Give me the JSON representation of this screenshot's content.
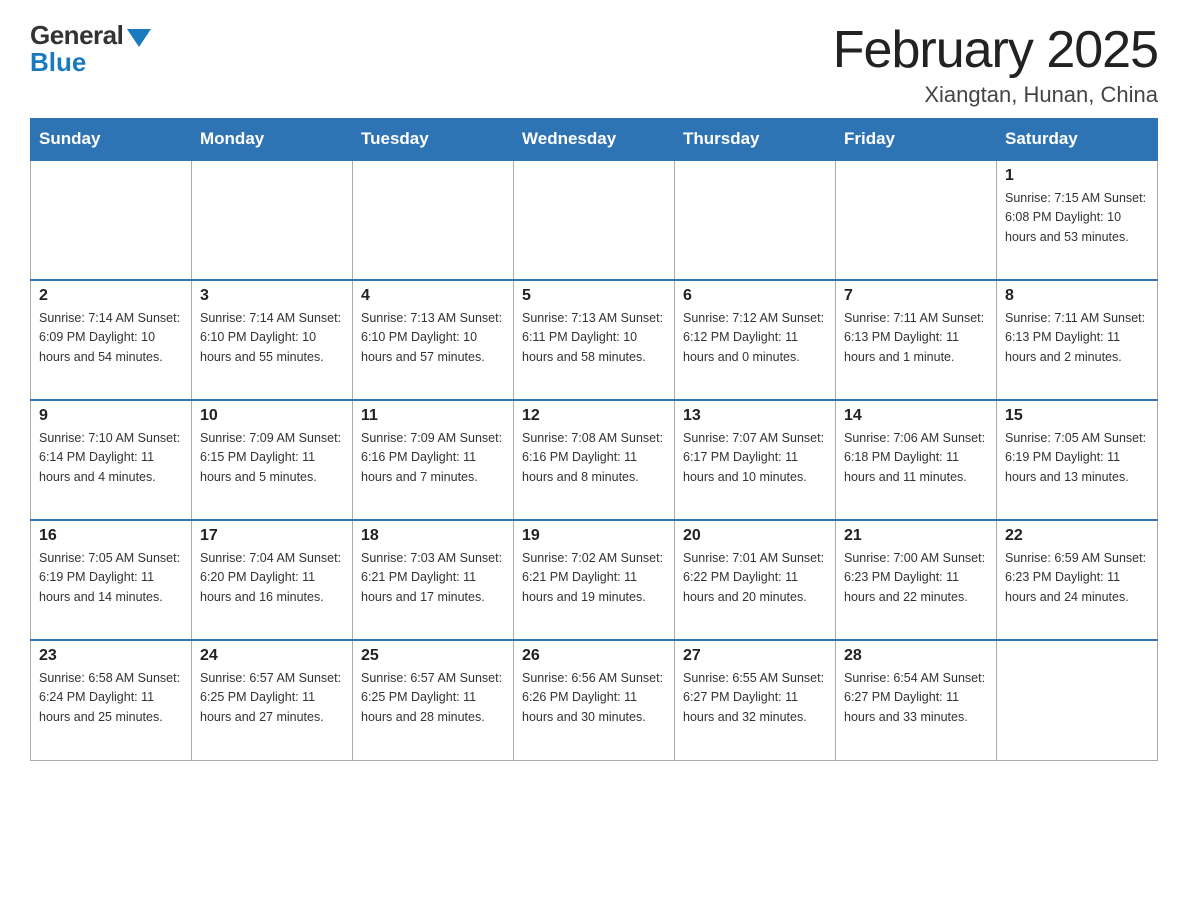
{
  "header": {
    "logo_general": "General",
    "logo_blue": "Blue",
    "title": "February 2025",
    "location": "Xiangtan, Hunan, China"
  },
  "days_of_week": [
    "Sunday",
    "Monday",
    "Tuesday",
    "Wednesday",
    "Thursday",
    "Friday",
    "Saturday"
  ],
  "weeks": [
    [
      {
        "day": "",
        "info": ""
      },
      {
        "day": "",
        "info": ""
      },
      {
        "day": "",
        "info": ""
      },
      {
        "day": "",
        "info": ""
      },
      {
        "day": "",
        "info": ""
      },
      {
        "day": "",
        "info": ""
      },
      {
        "day": "1",
        "info": "Sunrise: 7:15 AM\nSunset: 6:08 PM\nDaylight: 10 hours\nand 53 minutes."
      }
    ],
    [
      {
        "day": "2",
        "info": "Sunrise: 7:14 AM\nSunset: 6:09 PM\nDaylight: 10 hours\nand 54 minutes."
      },
      {
        "day": "3",
        "info": "Sunrise: 7:14 AM\nSunset: 6:10 PM\nDaylight: 10 hours\nand 55 minutes."
      },
      {
        "day": "4",
        "info": "Sunrise: 7:13 AM\nSunset: 6:10 PM\nDaylight: 10 hours\nand 57 minutes."
      },
      {
        "day": "5",
        "info": "Sunrise: 7:13 AM\nSunset: 6:11 PM\nDaylight: 10 hours\nand 58 minutes."
      },
      {
        "day": "6",
        "info": "Sunrise: 7:12 AM\nSunset: 6:12 PM\nDaylight: 11 hours\nand 0 minutes."
      },
      {
        "day": "7",
        "info": "Sunrise: 7:11 AM\nSunset: 6:13 PM\nDaylight: 11 hours\nand 1 minute."
      },
      {
        "day": "8",
        "info": "Sunrise: 7:11 AM\nSunset: 6:13 PM\nDaylight: 11 hours\nand 2 minutes."
      }
    ],
    [
      {
        "day": "9",
        "info": "Sunrise: 7:10 AM\nSunset: 6:14 PM\nDaylight: 11 hours\nand 4 minutes."
      },
      {
        "day": "10",
        "info": "Sunrise: 7:09 AM\nSunset: 6:15 PM\nDaylight: 11 hours\nand 5 minutes."
      },
      {
        "day": "11",
        "info": "Sunrise: 7:09 AM\nSunset: 6:16 PM\nDaylight: 11 hours\nand 7 minutes."
      },
      {
        "day": "12",
        "info": "Sunrise: 7:08 AM\nSunset: 6:16 PM\nDaylight: 11 hours\nand 8 minutes."
      },
      {
        "day": "13",
        "info": "Sunrise: 7:07 AM\nSunset: 6:17 PM\nDaylight: 11 hours\nand 10 minutes."
      },
      {
        "day": "14",
        "info": "Sunrise: 7:06 AM\nSunset: 6:18 PM\nDaylight: 11 hours\nand 11 minutes."
      },
      {
        "day": "15",
        "info": "Sunrise: 7:05 AM\nSunset: 6:19 PM\nDaylight: 11 hours\nand 13 minutes."
      }
    ],
    [
      {
        "day": "16",
        "info": "Sunrise: 7:05 AM\nSunset: 6:19 PM\nDaylight: 11 hours\nand 14 minutes."
      },
      {
        "day": "17",
        "info": "Sunrise: 7:04 AM\nSunset: 6:20 PM\nDaylight: 11 hours\nand 16 minutes."
      },
      {
        "day": "18",
        "info": "Sunrise: 7:03 AM\nSunset: 6:21 PM\nDaylight: 11 hours\nand 17 minutes."
      },
      {
        "day": "19",
        "info": "Sunrise: 7:02 AM\nSunset: 6:21 PM\nDaylight: 11 hours\nand 19 minutes."
      },
      {
        "day": "20",
        "info": "Sunrise: 7:01 AM\nSunset: 6:22 PM\nDaylight: 11 hours\nand 20 minutes."
      },
      {
        "day": "21",
        "info": "Sunrise: 7:00 AM\nSunset: 6:23 PM\nDaylight: 11 hours\nand 22 minutes."
      },
      {
        "day": "22",
        "info": "Sunrise: 6:59 AM\nSunset: 6:23 PM\nDaylight: 11 hours\nand 24 minutes."
      }
    ],
    [
      {
        "day": "23",
        "info": "Sunrise: 6:58 AM\nSunset: 6:24 PM\nDaylight: 11 hours\nand 25 minutes."
      },
      {
        "day": "24",
        "info": "Sunrise: 6:57 AM\nSunset: 6:25 PM\nDaylight: 11 hours\nand 27 minutes."
      },
      {
        "day": "25",
        "info": "Sunrise: 6:57 AM\nSunset: 6:25 PM\nDaylight: 11 hours\nand 28 minutes."
      },
      {
        "day": "26",
        "info": "Sunrise: 6:56 AM\nSunset: 6:26 PM\nDaylight: 11 hours\nand 30 minutes."
      },
      {
        "day": "27",
        "info": "Sunrise: 6:55 AM\nSunset: 6:27 PM\nDaylight: 11 hours\nand 32 minutes."
      },
      {
        "day": "28",
        "info": "Sunrise: 6:54 AM\nSunset: 6:27 PM\nDaylight: 11 hours\nand 33 minutes."
      },
      {
        "day": "",
        "info": ""
      }
    ]
  ]
}
